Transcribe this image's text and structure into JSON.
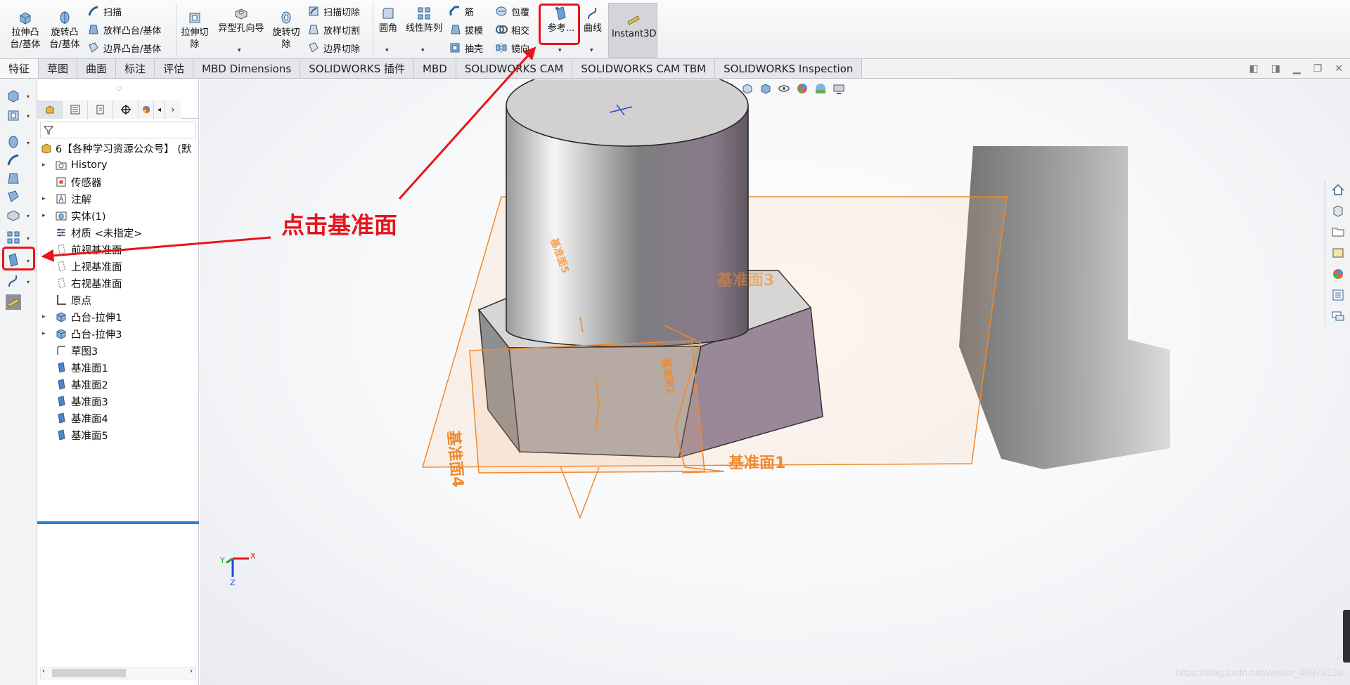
{
  "ribbon": {
    "extrude_boss": "拉伸凸\n台/基体",
    "revolve_boss": "旋转凸\n台/基体",
    "sweep": "扫描",
    "loft": "放样凸台/基体",
    "boundary": "边界凸台/基体",
    "extrude_cut": "拉伸切\n除",
    "hole_wizard": "异型孔向导",
    "revolve_cut": "旋转切\n除",
    "sweep_cut": "扫描切除",
    "loft_cut": "放样切割",
    "boundary_cut": "边界切除",
    "fillet": "圆角",
    "linear_pattern": "线性阵列",
    "rib": "筋",
    "draft": "拔模",
    "shell": "抽壳",
    "wrap": "包覆",
    "intersect": "相交",
    "mirror": "镜向",
    "reference": "参考...",
    "curves": "曲线",
    "instant3d": "Instant3D"
  },
  "tabs": [
    "特征",
    "草图",
    "曲面",
    "标注",
    "评估",
    "MBD Dimensions",
    "SOLIDWORKS 插件",
    "MBD",
    "SOLIDWORKS CAM",
    "SOLIDWORKS CAM TBM",
    "SOLIDWORKS Inspection"
  ],
  "tree": {
    "root": "6【各种学习资源公众号】 (默",
    "items": [
      {
        "label": "History",
        "icon": "history-folder-icon",
        "expand": true
      },
      {
        "label": "传感器",
        "icon": "sensor-icon",
        "expand": false
      },
      {
        "label": "注解",
        "icon": "annotation-icon",
        "expand": true
      },
      {
        "label": "实体(1)",
        "icon": "solid-bodies-icon",
        "expand": true
      },
      {
        "label": "材质 <未指定>",
        "icon": "material-icon",
        "expand": false
      },
      {
        "label": "前视基准面",
        "icon": "plane-icon",
        "expand": false
      },
      {
        "label": "上视基准面",
        "icon": "plane-icon",
        "expand": false
      },
      {
        "label": "右视基准面",
        "icon": "plane-icon",
        "expand": false
      },
      {
        "label": "原点",
        "icon": "origin-icon",
        "expand": false
      },
      {
        "label": "凸台-拉伸1",
        "icon": "extrude-feature-icon",
        "expand": true
      },
      {
        "label": "凸台-拉伸3",
        "icon": "extrude-feature-icon",
        "expand": true
      },
      {
        "label": "草图3",
        "icon": "sketch-icon",
        "expand": false
      },
      {
        "label": "基准面1",
        "icon": "ref-plane-icon",
        "expand": false
      },
      {
        "label": "基准面2",
        "icon": "ref-plane-icon",
        "expand": false
      },
      {
        "label": "基准面3",
        "icon": "ref-plane-icon",
        "expand": false
      },
      {
        "label": "基准面4",
        "icon": "ref-plane-icon",
        "expand": false
      },
      {
        "label": "基准面5",
        "icon": "ref-plane-icon",
        "expand": false
      }
    ]
  },
  "annotation": "点击基准面",
  "model_labels": {
    "plane1": "基准面1",
    "plane3": "基准面3",
    "plane4": "基准面4",
    "plane_side": "基准面2",
    "plane_cyl": "基准面5"
  },
  "triad": {
    "x": "X",
    "y": "Y",
    "z": "Z"
  },
  "watermark": "https://blog.csdn.net/weixin_40973138",
  "colors": {
    "annotation_red": "#e8141b",
    "plane_orange": "#f08a2c",
    "selection_blue": "#2b7fd4"
  }
}
